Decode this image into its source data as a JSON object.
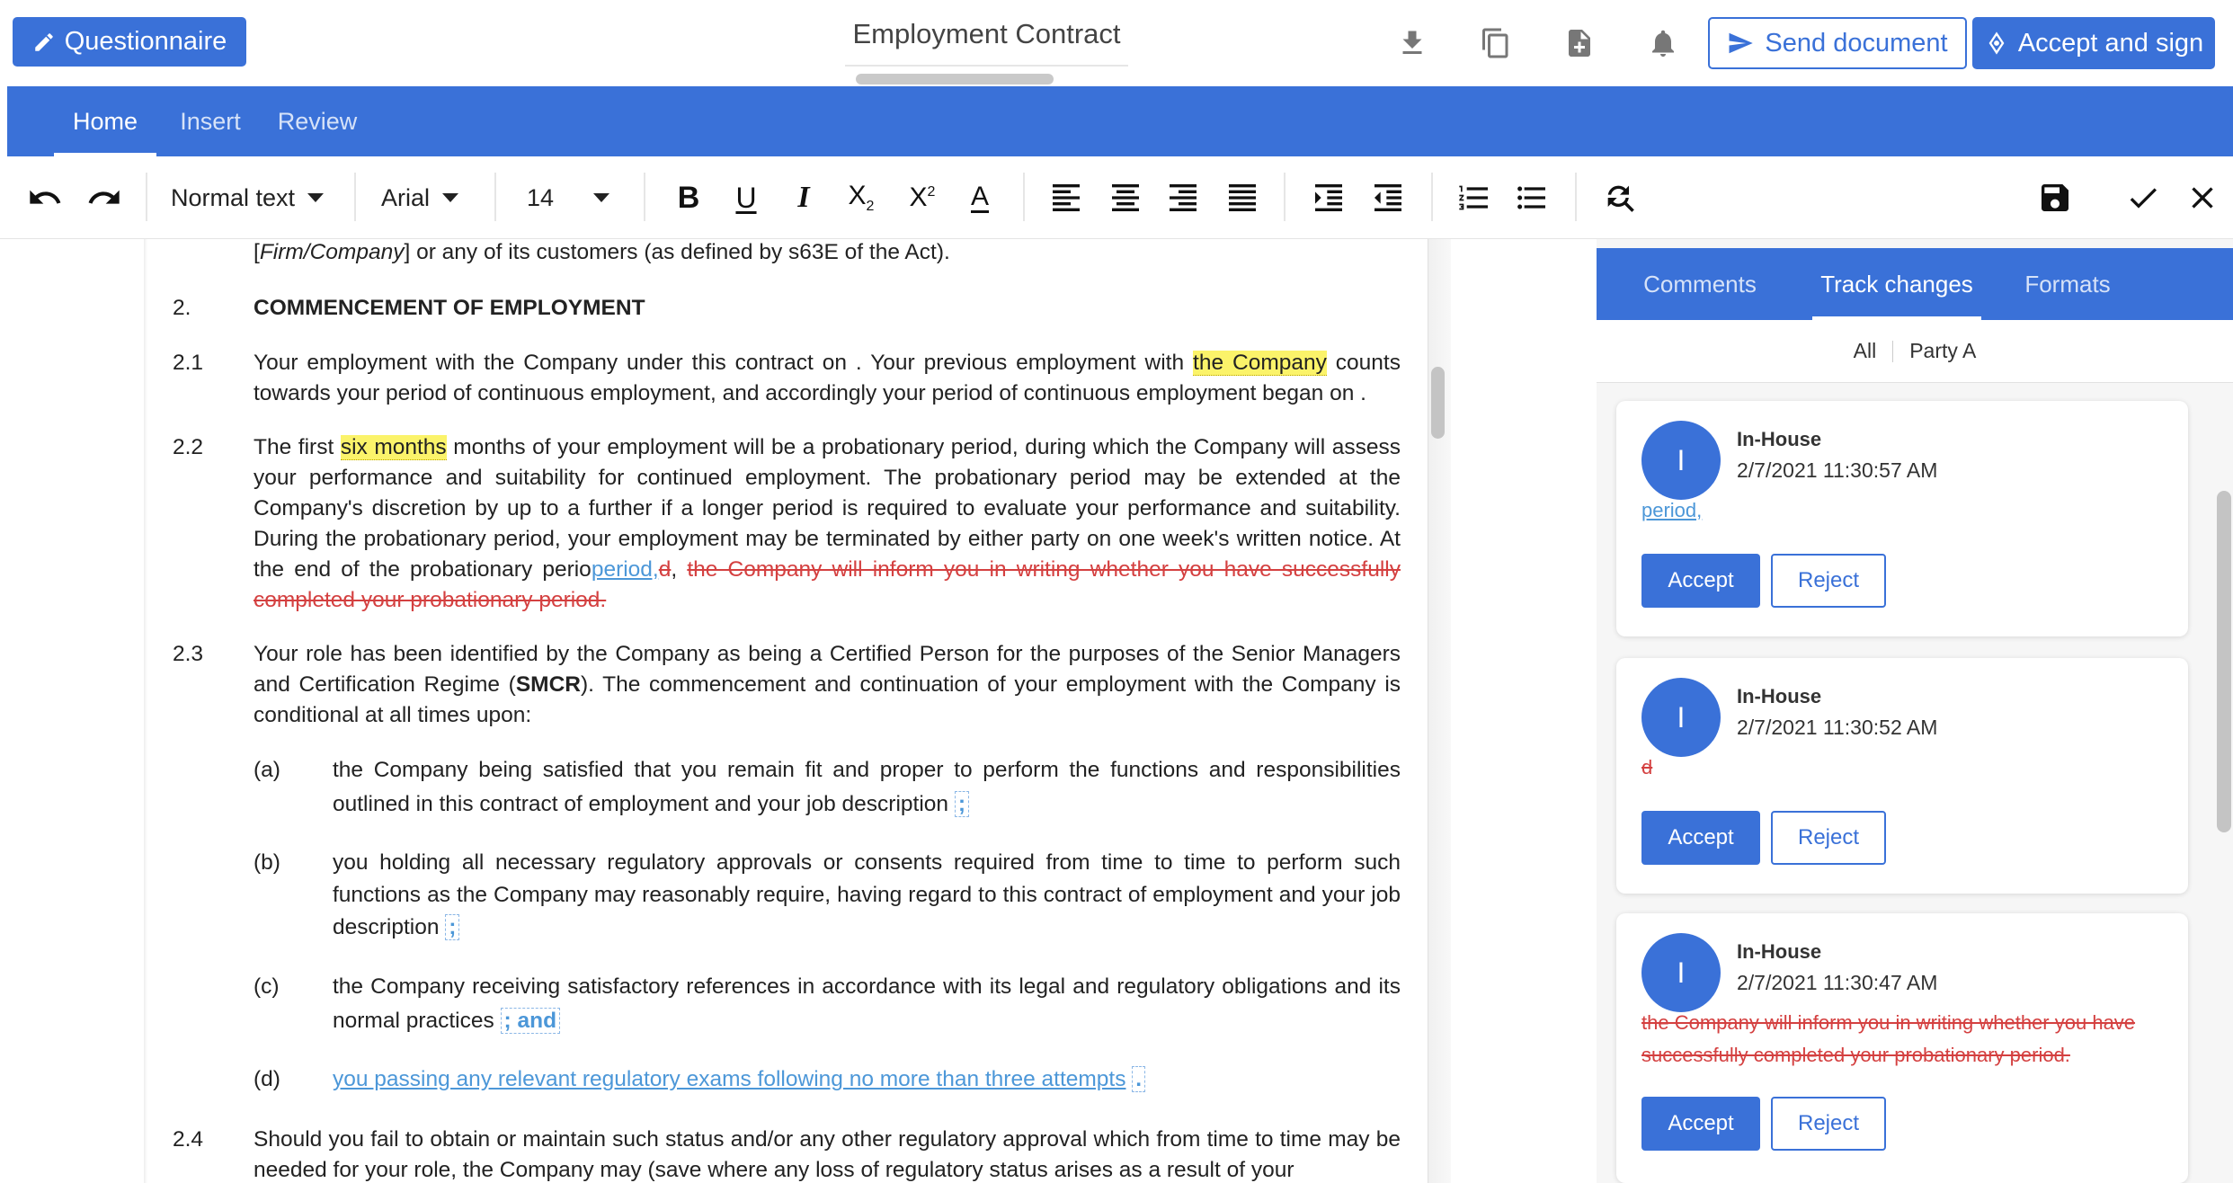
{
  "header": {
    "questionnaire_label": "Questionnaire",
    "title": "Employment Contract",
    "send_label": "Send document",
    "accept_sign_label": "Accept and sign"
  },
  "ribbon": {
    "tabs": [
      "Home",
      "Insert",
      "Review"
    ],
    "active": "Home"
  },
  "toolbar": {
    "style_value": "Normal text",
    "font_value": "Arial",
    "size_value": "14"
  },
  "document": {
    "top_line": {
      "pre": "[",
      "italic": "Firm/Company",
      "post": "] or any of its customers (as defined by s63E of the Act)."
    },
    "section2": {
      "num": "2.",
      "heading": "COMMENCEMENT OF EMPLOYMENT"
    },
    "p21": {
      "num": "2.1",
      "a": "Your employment with the Company under this contract  on . Your previous employment with ",
      "hl": "the Company",
      "b": " counts towards your period of continuous employment, and accordingly your period of continuous employment began on ."
    },
    "p22": {
      "num": "2.2",
      "a": "The first ",
      "hl": "six months",
      "b": " months of your employment will be a probationary period, during which the Company will assess your performance and suitability for continued employment. The probationary period may be extended at the Company's discretion by up to a further  if a longer period is required to evaluate your performance and suitability. During the probationary period, your employment may be terminated by either party on one week's written notice. At the end of the probationary perio",
      "ins": "period,",
      "del1": "d",
      "c": ", ",
      "del2": "the Company will inform you in writing whether you have successfully completed your probationary period."
    },
    "p23": {
      "num": "2.3",
      "a": "Your role has been identified by the Company as being a Certified Person for the purposes of the Senior Managers and Certification Regime (",
      "bold": "SMCR",
      "b": "). The commencement and continuation of your employment with the Company is conditional at all times upon:"
    },
    "items": [
      {
        "label": "(a)",
        "text": "the Company being satisfied that you remain fit and proper to perform the functions and responsibilities outlined in this contract of employment and your job description",
        "mark": ";"
      },
      {
        "label": "(b)",
        "text": "you holding all necessary regulatory approvals or consents required from time to time to perform such functions as the Company may reasonably require, having regard to this contract of employment and your job description",
        "mark": ";"
      },
      {
        "label": "(c)",
        "text": "the Company receiving satisfactory references in accordance with its legal and regulatory obligations and its normal practices",
        "mark": "; and"
      },
      {
        "label": "(d)",
        "ins": "you passing any relevant regulatory exams following no more than three attempts",
        "mark": "."
      }
    ],
    "p24": {
      "num": "2.4",
      "text": "Should you fail to obtain or maintain such status and/or any other regulatory approval which from time to time may be needed for your role, the Company may (save where any loss of regulatory status arises as a result of your"
    }
  },
  "panel": {
    "tabs": [
      "Comments",
      "Track changes",
      "Formats"
    ],
    "active": "Track changes",
    "filter": {
      "all": "All",
      "party": "Party A"
    },
    "cards": [
      {
        "initial": "I",
        "author": "In-House",
        "time": "2/7/2021 11:30:57 AM",
        "change": "period,",
        "kind": "insert",
        "accept": "Accept",
        "reject": "Reject"
      },
      {
        "initial": "I",
        "author": "In-House",
        "time": "2/7/2021 11:30:52 AM",
        "change": "d",
        "kind": "delete",
        "accept": "Accept",
        "reject": "Reject"
      },
      {
        "initial": "I",
        "author": "In-House",
        "time": "2/7/2021 11:30:47 AM",
        "change": "the Company will inform you in writing whether you have successfully completed your probationary period.",
        "kind": "delete",
        "accept": "Accept",
        "reject": "Reject"
      }
    ]
  },
  "colors": {
    "primary": "#3a71d8",
    "insert": "#4c97d8",
    "delete": "#d44040",
    "highlight": "#fbf36a"
  },
  "icons": [
    "pencil-icon",
    "download-icon",
    "copy-icon",
    "new-file-icon",
    "bell-icon",
    "send-icon",
    "pen-nib-icon",
    "undo-icon",
    "redo-icon",
    "bold-icon",
    "underline-icon",
    "italic-icon",
    "subscript-icon",
    "superscript-icon",
    "font-color-icon",
    "align-left-icon",
    "align-center-icon",
    "align-right-icon",
    "justify-icon",
    "indent-icon",
    "outdent-icon",
    "numbered-list-icon",
    "bullet-list-icon",
    "find-replace-icon",
    "save-icon",
    "check-icon",
    "close-icon"
  ]
}
